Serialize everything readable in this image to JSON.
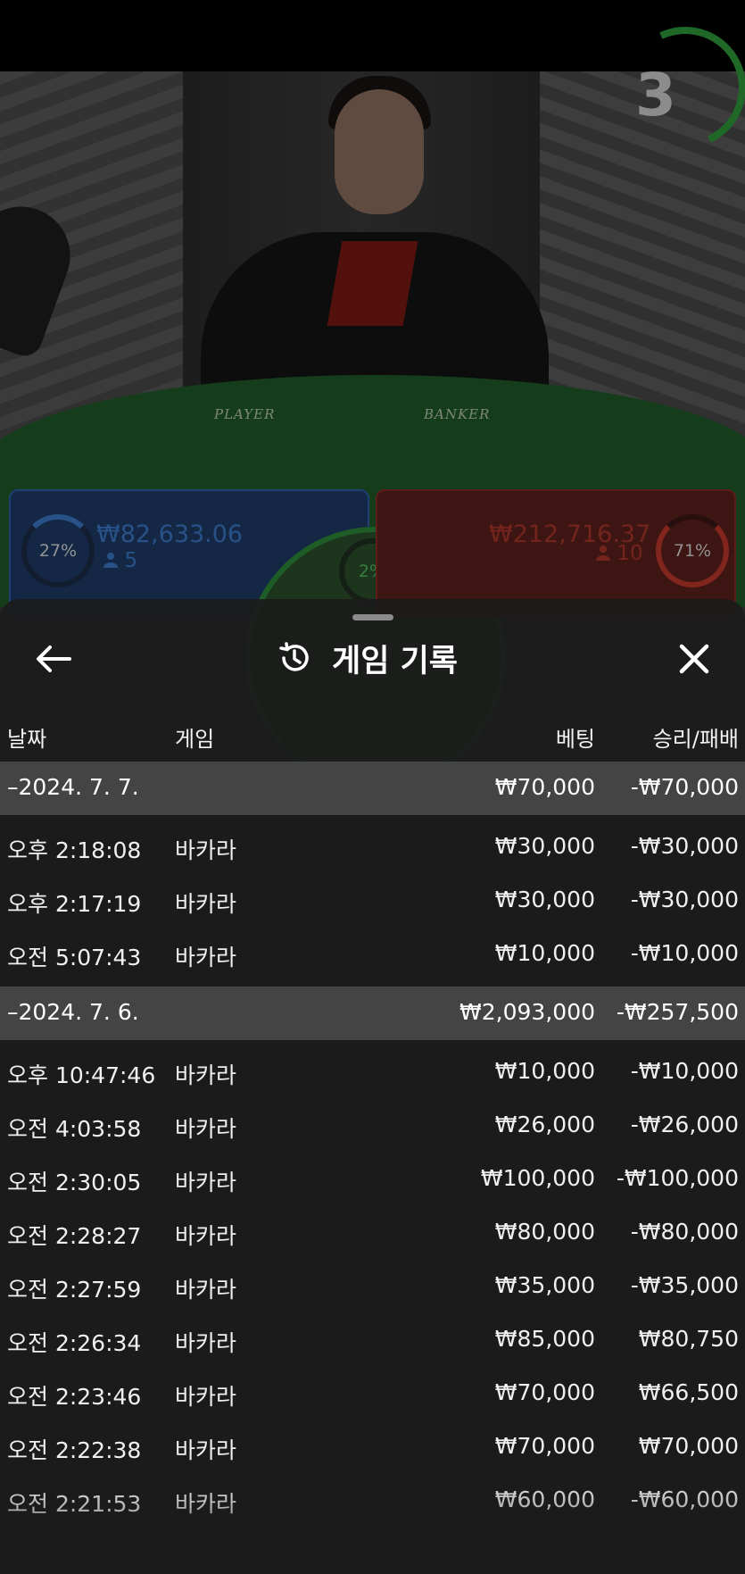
{
  "video": {
    "countdown": "3",
    "table_labels": {
      "player": "PLAYER",
      "banker": "BANKER"
    },
    "player_panel": {
      "percent": "27%",
      "amount": "₩82,633.06",
      "count": "5",
      "count_icon": "person-icon"
    },
    "banker_panel": {
      "percent": "71%",
      "amount": "₩212,716.37",
      "count": "10",
      "count_icon": "person-icon"
    },
    "tie_panel": {
      "percent": "2%"
    },
    "colors": {
      "player": "#2f5fa8",
      "banker": "#a8352c",
      "tie": "#2f8a3a",
      "table": "#1f5a2a"
    }
  },
  "sheet": {
    "title": "게임 기록",
    "title_icon": "history-icon",
    "back_icon": "arrow-left-icon",
    "close_icon": "close-icon",
    "columns": {
      "date": "날짜",
      "game": "게임",
      "bet": "베팅",
      "result": "승리/패배"
    },
    "rows": [
      {
        "type": "group",
        "date": "–2024. 7. 7.",
        "game": "",
        "bet": "₩70,000",
        "result": "-₩70,000"
      },
      {
        "type": "item",
        "date": "오후 2:18:08",
        "game": "바카라",
        "bet": "₩30,000",
        "result": "-₩30,000"
      },
      {
        "type": "item",
        "date": "오후 2:17:19",
        "game": "바카라",
        "bet": "₩30,000",
        "result": "-₩30,000"
      },
      {
        "type": "item",
        "date": "오전 5:07:43",
        "game": "바카라",
        "bet": "₩10,000",
        "result": "-₩10,000"
      },
      {
        "type": "group",
        "date": "–2024. 7. 6.",
        "game": "",
        "bet": "₩2,093,000",
        "result": "-₩257,500"
      },
      {
        "type": "item",
        "date": "오후 10:47:46",
        "game": "바카라",
        "bet": "₩10,000",
        "result": "-₩10,000"
      },
      {
        "type": "item",
        "date": "오전 4:03:58",
        "game": "바카라",
        "bet": "₩26,000",
        "result": "-₩26,000"
      },
      {
        "type": "item",
        "date": "오전 2:30:05",
        "game": "바카라",
        "bet": "₩100,000",
        "result": "-₩100,000"
      },
      {
        "type": "item",
        "date": "오전 2:28:27",
        "game": "바카라",
        "bet": "₩80,000",
        "result": "-₩80,000"
      },
      {
        "type": "item",
        "date": "오전 2:27:59",
        "game": "바카라",
        "bet": "₩35,000",
        "result": "-₩35,000"
      },
      {
        "type": "item",
        "date": "오전 2:26:34",
        "game": "바카라",
        "bet": "₩85,000",
        "result": "₩80,750"
      },
      {
        "type": "item",
        "date": "오전 2:23:46",
        "game": "바카라",
        "bet": "₩70,000",
        "result": "₩66,500"
      },
      {
        "type": "item",
        "date": "오전 2:22:38",
        "game": "바카라",
        "bet": "₩70,000",
        "result": "₩70,000"
      },
      {
        "type": "item",
        "date": "오전 2:21:53",
        "game": "바카라",
        "bet": "₩60,000",
        "result": "-₩60,000"
      }
    ]
  }
}
